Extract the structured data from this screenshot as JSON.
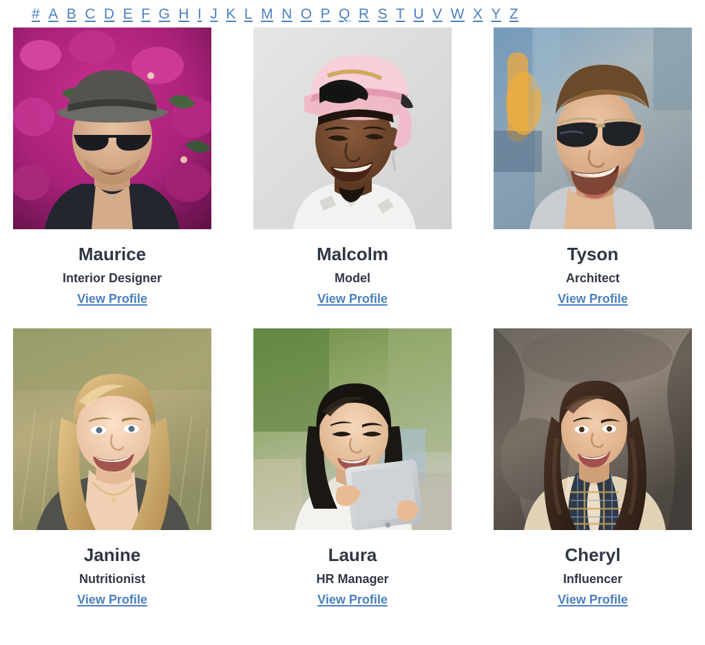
{
  "alphabet_nav": {
    "links": [
      "#",
      "A",
      "B",
      "C",
      "D",
      "E",
      "F",
      "G",
      "H",
      "I",
      "J",
      "K",
      "L",
      "M",
      "N",
      "O",
      "P",
      "Q",
      "R",
      "S",
      "T",
      "U",
      "V",
      "W",
      "X",
      "Y",
      "Z"
    ]
  },
  "colors": {
    "link": "#4a7fc0",
    "text": "#2f3745",
    "background": "#ffffff"
  },
  "profiles": [
    {
      "name": "Maurice",
      "role": "Interior Designer",
      "link_label": "View Profile",
      "photo_alt": "man in grey fedora hat and dark sunglasses smiling in front of magenta bougainvillea flowers"
    },
    {
      "name": "Malcolm",
      "role": "Model",
      "link_label": "View Profile",
      "photo_alt": "smiling man wearing a pink snapback cap and white shirt on a light grey studio background"
    },
    {
      "name": "Tyson",
      "role": "Architect",
      "link_label": "View Profile",
      "photo_alt": "laughing man with dark sunglasses outdoors with a blurred street background"
    },
    {
      "name": "Janine",
      "role": "Nutritionist",
      "link_label": "View Profile",
      "photo_alt": "smiling blonde woman in an olive top in a dry grass field"
    },
    {
      "name": "Laura",
      "role": "HR Manager",
      "link_label": "View Profile",
      "photo_alt": "smiling young woman holding a tablet outdoors with green foliage behind"
    },
    {
      "name": "Cheryl",
      "role": "Influencer",
      "link_label": "View Profile",
      "photo_alt": "smiling woman with long dark hair wearing a cream coat and plaid scarf against a rock wall"
    }
  ]
}
